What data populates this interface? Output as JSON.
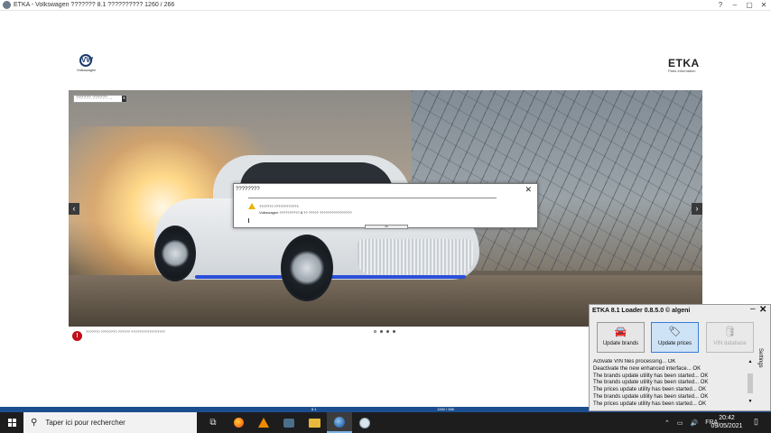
{
  "window": {
    "title": "ETKA - Volkswagen ??????? 8.1 ?????????? 1260 / 266",
    "controls": [
      "?",
      "–",
      "▢",
      "✕"
    ]
  },
  "logos": {
    "vw_letters": "VW",
    "vw_text": "Volkswagen",
    "etka": "ETKA",
    "etka_sub": "Parts Information"
  },
  "hero": {
    "search_placeholder": "?????? ?????? ...",
    "search_clear": "x",
    "nav_left": "‹",
    "nav_right": "›"
  },
  "dialog": {
    "title": "????????",
    "close": "✕",
    "line1": "??????? ????????????:",
    "line2": "Volkswagen ?????????? 8.?? ????? ????????????????",
    "ok": "Ok"
  },
  "notice": {
    "icon": "!",
    "text": "???????   ???????? ??????   ?????????????????"
  },
  "carousel": {
    "dots": 4,
    "active_index": 0
  },
  "statusbar": {
    "left": "8.1",
    "right": "1260 / 266"
  },
  "loader": {
    "title": "ETKA 8.1 Loader 0.8.5.0 © algeni",
    "minimize": "–",
    "close": "✕",
    "buttons": [
      {
        "label": "Update brands",
        "icon": "car-icon",
        "glyph": "🚘"
      },
      {
        "label": "Update prices",
        "icon": "price-tag-icon",
        "glyph": "🏷"
      },
      {
        "label": "VIN database",
        "icon": "database-icon",
        "glyph": "🛢"
      }
    ],
    "log": [
      "Activate VIN files processing... OK",
      "Deactivate the new enhanced interface... OK",
      "The brands update utility has been started... OK",
      "The brands update utility has been started... OK",
      "The prices update utility has been started... OK",
      "The brands update utility has been started... OK",
      "The prices update utility has been started... OK"
    ],
    "settings_label": "Settings"
  },
  "taskbar": {
    "search_placeholder": "Taper ici pour rechercher",
    "tray_chevron": "⌃",
    "tray_keyboard": "▭",
    "tray_volume": "🔊",
    "language": "FRA",
    "time": "20:42",
    "date": "09/05/2021",
    "notifications": "▯"
  }
}
